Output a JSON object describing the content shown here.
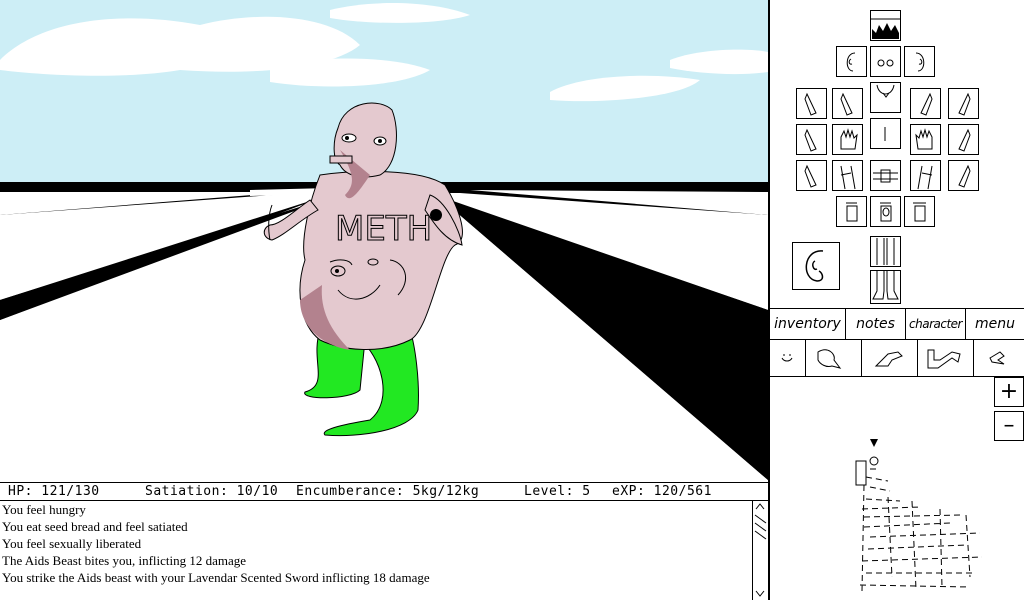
{
  "stats": {
    "hp": "HP: 121/130",
    "satiation": "Satiation: 10/10",
    "encumbrance": "Encumberance: 5kg/12kg",
    "level": "Level: 5",
    "exp": "eXP: 120/561"
  },
  "creature_shirt_text": "METH",
  "log": [
    "You feel hungry",
    "You eat seed bread and feel satiated",
    "You feel sexually liberated",
    "The Aids Beast bites you, inflicting 12 damage",
    "You strike the Aids beast with your Lavendar Scented Sword inflicting 18 damage"
  ],
  "tabs": [
    "inventory",
    "notes",
    "character",
    "menu"
  ],
  "map_controls": {
    "zoom_in": "+",
    "zoom_out": "–"
  },
  "colors": {
    "sky": "#cdeef6",
    "ground": "#ffffff",
    "road_stripe": "#000000",
    "creature_skin": "#e4c9cf",
    "creature_shadow": "#b3828e",
    "pants": "#22e822"
  }
}
